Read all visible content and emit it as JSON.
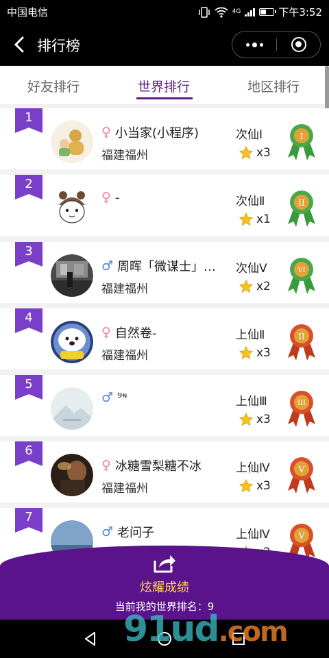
{
  "status_bar": {
    "carrier": "中国电信",
    "time": "下午3:52",
    "network": "4G"
  },
  "nav": {
    "title": "排行榜"
  },
  "tabs": [
    {
      "label": "好友排行",
      "active": false
    },
    {
      "label": "世界排行",
      "active": true
    },
    {
      "label": "地区排行",
      "active": false
    }
  ],
  "rows": [
    {
      "rank": "1",
      "gender": "♀",
      "name": "小当家(小程序)",
      "region": "福建福州",
      "title": "次仙Ⅰ",
      "stars": "x3",
      "medal": "I",
      "medal_color": "green"
    },
    {
      "rank": "2",
      "gender": "♀",
      "name": "-",
      "region": "",
      "title": "次仙Ⅱ",
      "stars": "x1",
      "medal": "II",
      "medal_color": "green"
    },
    {
      "rank": "3",
      "gender": "♂",
      "name": "周晖「微谋士」…",
      "region": "福建福州",
      "title": "次仙Ⅴ",
      "stars": "x2",
      "medal": "VI",
      "medal_color": "green"
    },
    {
      "rank": "4",
      "gender": "♀",
      "name": "自然卷-",
      "region": "福建福州",
      "title": "上仙Ⅱ",
      "stars": "x3",
      "medal": "II",
      "medal_color": "red"
    },
    {
      "rank": "5",
      "gender": "♂",
      "name": "⁹ᶰ",
      "region": "",
      "title": "上仙Ⅲ",
      "stars": "x3",
      "medal": "III",
      "medal_color": "red"
    },
    {
      "rank": "6",
      "gender": "♀",
      "name": "冰糖雪梨糖不冰",
      "region": "福建福州",
      "title": "上仙Ⅳ",
      "stars": "x3",
      "medal": "V",
      "medal_color": "red"
    },
    {
      "rank": "7",
      "gender": "♂",
      "name": "老问子",
      "region": "",
      "title": "上仙Ⅳ",
      "stars": "x2",
      "medal": "V",
      "medal_color": "red"
    }
  ],
  "share": {
    "label": "炫耀成绩",
    "my_rank": "当前我的世界排名：9"
  },
  "watermark": {
    "text": "91ud",
    "suffix": ".com"
  },
  "colors": {
    "accent": "#5b1f8c",
    "rank_flag": "#7a3fc8",
    "panel": "#5a138a",
    "share_text": "#ffd34e"
  }
}
